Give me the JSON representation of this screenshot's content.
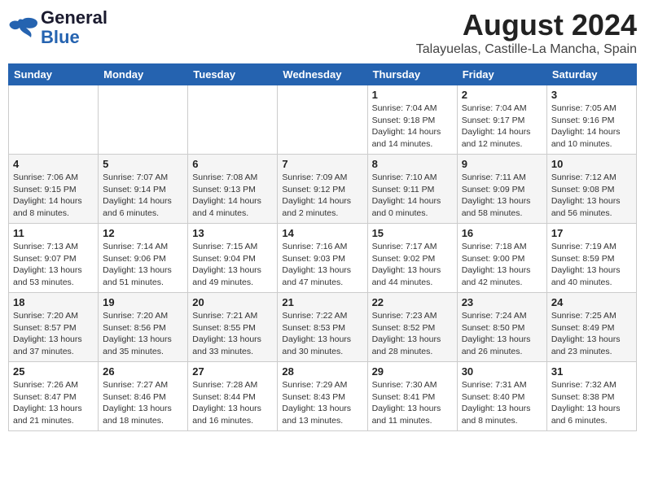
{
  "header": {
    "logo_general": "General",
    "logo_blue": "Blue",
    "month_year": "August 2024",
    "location": "Talayuelas, Castille-La Mancha, Spain"
  },
  "weekdays": [
    "Sunday",
    "Monday",
    "Tuesday",
    "Wednesday",
    "Thursday",
    "Friday",
    "Saturday"
  ],
  "weeks": [
    [
      {
        "day": "",
        "info": ""
      },
      {
        "day": "",
        "info": ""
      },
      {
        "day": "",
        "info": ""
      },
      {
        "day": "",
        "info": ""
      },
      {
        "day": "1",
        "info": "Sunrise: 7:04 AM\nSunset: 9:18 PM\nDaylight: 14 hours\nand 14 minutes."
      },
      {
        "day": "2",
        "info": "Sunrise: 7:04 AM\nSunset: 9:17 PM\nDaylight: 14 hours\nand 12 minutes."
      },
      {
        "day": "3",
        "info": "Sunrise: 7:05 AM\nSunset: 9:16 PM\nDaylight: 14 hours\nand 10 minutes."
      }
    ],
    [
      {
        "day": "4",
        "info": "Sunrise: 7:06 AM\nSunset: 9:15 PM\nDaylight: 14 hours\nand 8 minutes."
      },
      {
        "day": "5",
        "info": "Sunrise: 7:07 AM\nSunset: 9:14 PM\nDaylight: 14 hours\nand 6 minutes."
      },
      {
        "day": "6",
        "info": "Sunrise: 7:08 AM\nSunset: 9:13 PM\nDaylight: 14 hours\nand 4 minutes."
      },
      {
        "day": "7",
        "info": "Sunrise: 7:09 AM\nSunset: 9:12 PM\nDaylight: 14 hours\nand 2 minutes."
      },
      {
        "day": "8",
        "info": "Sunrise: 7:10 AM\nSunset: 9:11 PM\nDaylight: 14 hours\nand 0 minutes."
      },
      {
        "day": "9",
        "info": "Sunrise: 7:11 AM\nSunset: 9:09 PM\nDaylight: 13 hours\nand 58 minutes."
      },
      {
        "day": "10",
        "info": "Sunrise: 7:12 AM\nSunset: 9:08 PM\nDaylight: 13 hours\nand 56 minutes."
      }
    ],
    [
      {
        "day": "11",
        "info": "Sunrise: 7:13 AM\nSunset: 9:07 PM\nDaylight: 13 hours\nand 53 minutes."
      },
      {
        "day": "12",
        "info": "Sunrise: 7:14 AM\nSunset: 9:06 PM\nDaylight: 13 hours\nand 51 minutes."
      },
      {
        "day": "13",
        "info": "Sunrise: 7:15 AM\nSunset: 9:04 PM\nDaylight: 13 hours\nand 49 minutes."
      },
      {
        "day": "14",
        "info": "Sunrise: 7:16 AM\nSunset: 9:03 PM\nDaylight: 13 hours\nand 47 minutes."
      },
      {
        "day": "15",
        "info": "Sunrise: 7:17 AM\nSunset: 9:02 PM\nDaylight: 13 hours\nand 44 minutes."
      },
      {
        "day": "16",
        "info": "Sunrise: 7:18 AM\nSunset: 9:00 PM\nDaylight: 13 hours\nand 42 minutes."
      },
      {
        "day": "17",
        "info": "Sunrise: 7:19 AM\nSunset: 8:59 PM\nDaylight: 13 hours\nand 40 minutes."
      }
    ],
    [
      {
        "day": "18",
        "info": "Sunrise: 7:20 AM\nSunset: 8:57 PM\nDaylight: 13 hours\nand 37 minutes."
      },
      {
        "day": "19",
        "info": "Sunrise: 7:20 AM\nSunset: 8:56 PM\nDaylight: 13 hours\nand 35 minutes."
      },
      {
        "day": "20",
        "info": "Sunrise: 7:21 AM\nSunset: 8:55 PM\nDaylight: 13 hours\nand 33 minutes."
      },
      {
        "day": "21",
        "info": "Sunrise: 7:22 AM\nSunset: 8:53 PM\nDaylight: 13 hours\nand 30 minutes."
      },
      {
        "day": "22",
        "info": "Sunrise: 7:23 AM\nSunset: 8:52 PM\nDaylight: 13 hours\nand 28 minutes."
      },
      {
        "day": "23",
        "info": "Sunrise: 7:24 AM\nSunset: 8:50 PM\nDaylight: 13 hours\nand 26 minutes."
      },
      {
        "day": "24",
        "info": "Sunrise: 7:25 AM\nSunset: 8:49 PM\nDaylight: 13 hours\nand 23 minutes."
      }
    ],
    [
      {
        "day": "25",
        "info": "Sunrise: 7:26 AM\nSunset: 8:47 PM\nDaylight: 13 hours\nand 21 minutes."
      },
      {
        "day": "26",
        "info": "Sunrise: 7:27 AM\nSunset: 8:46 PM\nDaylight: 13 hours\nand 18 minutes."
      },
      {
        "day": "27",
        "info": "Sunrise: 7:28 AM\nSunset: 8:44 PM\nDaylight: 13 hours\nand 16 minutes."
      },
      {
        "day": "28",
        "info": "Sunrise: 7:29 AM\nSunset: 8:43 PM\nDaylight: 13 hours\nand 13 minutes."
      },
      {
        "day": "29",
        "info": "Sunrise: 7:30 AM\nSunset: 8:41 PM\nDaylight: 13 hours\nand 11 minutes."
      },
      {
        "day": "30",
        "info": "Sunrise: 7:31 AM\nSunset: 8:40 PM\nDaylight: 13 hours\nand 8 minutes."
      },
      {
        "day": "31",
        "info": "Sunrise: 7:32 AM\nSunset: 8:38 PM\nDaylight: 13 hours\nand 6 minutes."
      }
    ]
  ]
}
